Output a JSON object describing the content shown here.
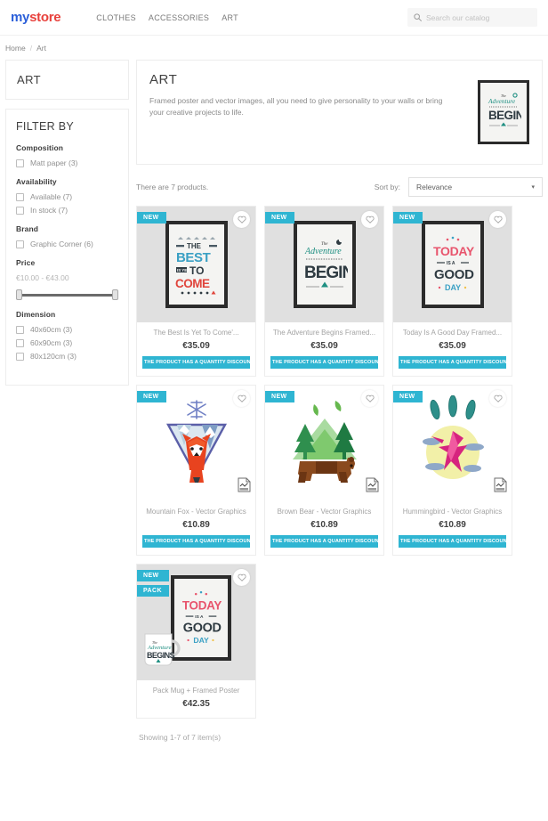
{
  "header": {
    "logo_my": "my",
    "logo_store": "store",
    "nav": [
      {
        "label": "CLOTHES"
      },
      {
        "label": "ACCESSORIES"
      },
      {
        "label": "ART"
      }
    ],
    "search": {
      "placeholder": "Search our catalog",
      "value": "",
      "icon": "search-icon"
    }
  },
  "breadcrumb": {
    "home": "Home",
    "separator": "/",
    "current": "Art"
  },
  "sidebar": {
    "category_title": "ART",
    "filter_title": "FILTER BY",
    "facets": [
      {
        "title": "Composition",
        "options": [
          {
            "label": "Matt paper (3)",
            "checked": false
          }
        ]
      },
      {
        "title": "Availability",
        "options": [
          {
            "label": "Available (7)",
            "checked": false
          },
          {
            "label": "In stock (7)",
            "checked": false
          }
        ]
      },
      {
        "title": "Brand",
        "options": [
          {
            "label": "Graphic Corner (6)",
            "checked": false
          }
        ]
      }
    ],
    "price": {
      "title": "Price",
      "range_label": "€10.00 - €43.00",
      "min": "€10.00",
      "max": "€43.00"
    },
    "dimension": {
      "title": "Dimension",
      "options": [
        {
          "label": "40x60cm (3)",
          "checked": false
        },
        {
          "label": "60x90cm (3)",
          "checked": false
        },
        {
          "label": "80x120cm (3)",
          "checked": false
        }
      ]
    }
  },
  "main": {
    "title": "ART",
    "description": "Framed poster and vector images, all you need to give personality to your walls or bring your creative projects to life.",
    "header_thumb_alt": "the-adventure-begins-poster",
    "product_count": "There are 7 products.",
    "sort_label": "Sort by:",
    "sort_value": "Relevance",
    "sort_caret": "▾",
    "showing": "Showing 1-7 of 7 item(s)",
    "discount_text": "THE PRODUCT HAS A QUANTITY DISCOUNT"
  },
  "products": [
    {
      "name": "The Best Is Yet To Come'...",
      "price": "€35.09",
      "badges": [
        "NEW"
      ],
      "has_discount": true,
      "thumb_style": "grey",
      "art": "best-yet-to-come",
      "file_icon": false
    },
    {
      "name": "The Adventure Begins Framed...",
      "price": "€35.09",
      "badges": [
        "NEW"
      ],
      "has_discount": true,
      "thumb_style": "grey",
      "art": "adventure-begins",
      "file_icon": false
    },
    {
      "name": "Today Is A Good Day Framed...",
      "price": "€35.09",
      "badges": [
        "NEW"
      ],
      "has_discount": true,
      "thumb_style": "grey",
      "art": "today-good-day",
      "file_icon": false
    },
    {
      "name": "Mountain Fox - Vector Graphics",
      "price": "€10.89",
      "badges": [
        "NEW"
      ],
      "has_discount": true,
      "thumb_style": "white",
      "art": "mountain-fox",
      "file_icon": true
    },
    {
      "name": "Brown Bear - Vector Graphics",
      "price": "€10.89",
      "badges": [
        "NEW"
      ],
      "has_discount": true,
      "thumb_style": "white",
      "art": "brown-bear",
      "file_icon": true
    },
    {
      "name": "Hummingbird - Vector Graphics",
      "price": "€10.89",
      "badges": [
        "NEW"
      ],
      "has_discount": true,
      "thumb_style": "white",
      "art": "hummingbird",
      "file_icon": true
    },
    {
      "name": "Pack Mug + Framed Poster",
      "price": "€42.35",
      "badges": [
        "NEW",
        "PACK"
      ],
      "has_discount": false,
      "thumb_style": "grey",
      "art": "pack-mug-poster",
      "file_icon": false
    }
  ],
  "colors": {
    "accent": "#2fb5d2",
    "logo_blue": "#2b5fd9",
    "logo_red": "#e8413c",
    "text_dark": "#414141",
    "text_muted": "#8a8a8a"
  }
}
